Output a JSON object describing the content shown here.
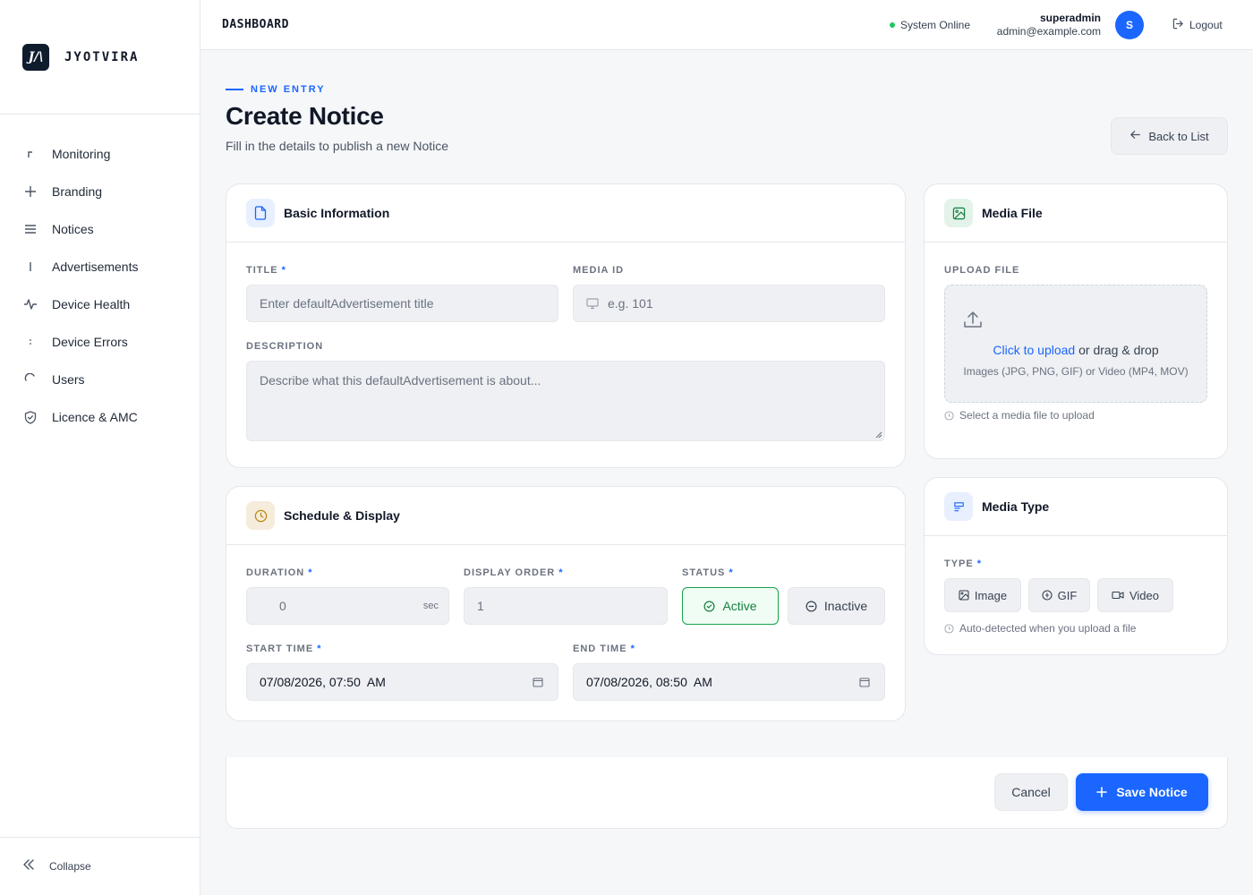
{
  "brand": {
    "name": "JYOTVIRA",
    "logo_text": "J/\\"
  },
  "sidebar": {
    "items": [
      {
        "label": "Monitoring",
        "icon": "corner-icon"
      },
      {
        "label": "Branding",
        "icon": "plus-icon"
      },
      {
        "label": "Notices",
        "icon": "menu-icon"
      },
      {
        "label": "Advertisements",
        "icon": "bar-icon"
      },
      {
        "label": "Device Health",
        "icon": "activity-icon"
      },
      {
        "label": "Device Errors",
        "icon": "dots-icon"
      },
      {
        "label": "Users",
        "icon": "loader-icon"
      },
      {
        "label": "Licence & AMC",
        "icon": "shield-check-icon"
      }
    ],
    "collapse_label": "Collapse"
  },
  "header": {
    "title": "DASHBOARD",
    "status": "System Online",
    "user_name": "superadmin",
    "user_email": "admin@example.com",
    "avatar_initial": "S",
    "logout_label": "Logout"
  },
  "page": {
    "eyebrow": "NEW ENTRY",
    "title": "Create Notice",
    "subtitle": "Fill in the details to publish a new Notice",
    "back_label": "Back to List"
  },
  "basic_info": {
    "title": "Basic Information",
    "title_label": "TITLE",
    "title_placeholder": "Enter defaultAdvertisement title",
    "media_id_label": "MEDIA ID",
    "media_id_placeholder": "e.g. 101",
    "description_label": "DESCRIPTION",
    "description_placeholder": "Describe what this defaultAdvertisement is about..."
  },
  "schedule": {
    "title": "Schedule & Display",
    "duration_label": "DURATION",
    "duration_value": "0",
    "duration_unit": "sec",
    "display_order_label": "DISPLAY ORDER",
    "display_order_value": "1",
    "status_label": "STATUS",
    "status_active": "Active",
    "status_inactive": "Inactive",
    "start_label": "START TIME",
    "start_value": "07/08/2026, 07:50  AM",
    "end_label": "END TIME",
    "end_value": "07/08/2026, 08:50  AM"
  },
  "media_file": {
    "title": "Media File",
    "upload_label": "UPLOAD FILE",
    "click_text": "Click to upload",
    "drag_text": "or drag & drop",
    "formats": "Images (JPG, PNG, GIF) or Video (MP4, MOV)",
    "hint": "Select a media file to upload"
  },
  "media_type": {
    "title": "Media Type",
    "type_label": "TYPE",
    "options": [
      "Image",
      "GIF",
      "Video"
    ],
    "hint": "Auto-detected when you upload a file"
  },
  "actions": {
    "cancel": "Cancel",
    "save": "Save Notice"
  },
  "colors": {
    "accent": "#1a66ff",
    "success": "#16a34a",
    "online": "#22c55e"
  }
}
